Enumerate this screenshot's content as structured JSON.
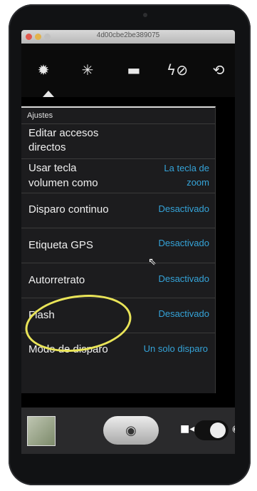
{
  "window": {
    "title": "4d00cbe2be389075"
  },
  "toolbar": {
    "icons": [
      "settings-gear-icon",
      "effects-sparkle-icon",
      "screen-rect-icon",
      "flash-off-icon",
      "switch-camera-icon"
    ]
  },
  "panel": {
    "header": "Ajustes",
    "rows": [
      {
        "label_line1": "Editar accesos",
        "label_line2": "directos",
        "value_line1": "",
        "value_line2": ""
      },
      {
        "label_line1": "Usar tecla",
        "label_line2": "volumen como",
        "value_line1": "La tecla de",
        "value_line2": "zoom"
      },
      {
        "label": "Disparo continuo",
        "value": "Desactivado"
      },
      {
        "label": "Etiqueta GPS",
        "value": "Desactivado"
      },
      {
        "label": "Autorretrato",
        "value": "Desactivado"
      },
      {
        "label": "Flash",
        "value": "Desactivado"
      },
      {
        "label": "Modo de disparo",
        "value": "Un solo disparo"
      }
    ]
  },
  "bottom": {
    "shutter_icon": "camera-icon",
    "video_icon": "video-camera-icon",
    "photo_icon": "camera-icon"
  },
  "colors": {
    "accent": "#35a3d8",
    "highlight_circle": "#e9e458"
  }
}
